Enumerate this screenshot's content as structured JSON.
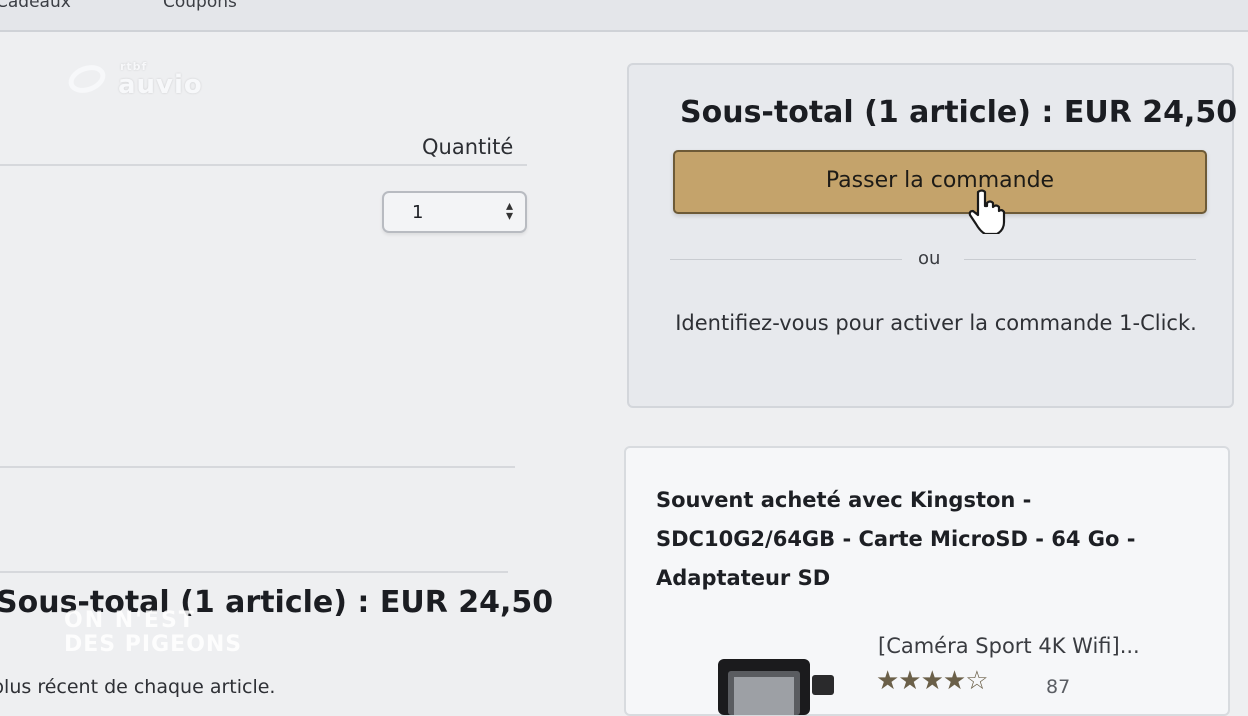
{
  "topbar": {
    "left_fragment": "Cadeaux",
    "coupons": "Coupons"
  },
  "watermark": {
    "small": "rtbf",
    "big": "auvio"
  },
  "cart": {
    "quantity_label": "Quantité",
    "quantity_value": "1",
    "subtotal_left": "Sous-total (1 article) : EUR 24,50",
    "note_fragment": "plus récent de chaque article."
  },
  "checkout": {
    "subtotal": "Sous-total (1 article) : EUR 24,50",
    "button_label": "Passer la commande",
    "or": "ou",
    "oneclick": "Identifiez-vous pour activer la commande 1-Click."
  },
  "fbt": {
    "title": "Souvent acheté avec Kingston - SDC10G2/64GB - Carte MicroSD - 64 Go - Adaptateur SD",
    "product_name": "[Caméra Sport 4K Wifi]...",
    "rating_stars": 4,
    "rating_count": "87"
  },
  "overlay_logo": {
    "line1": "ON N'EST",
    "line2": "DES PIGEONS"
  },
  "colors": {
    "button": "#c4a36b",
    "page_bg": "#eeeff1",
    "card_bg": "#e7e9ed"
  }
}
